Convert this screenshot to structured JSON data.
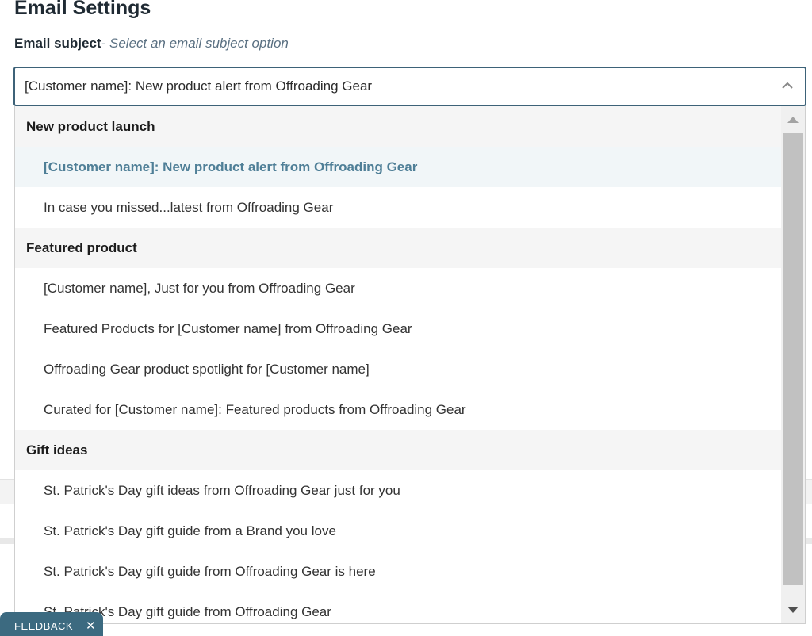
{
  "page": {
    "title": "Email Settings"
  },
  "email_subject": {
    "label": "Email subject",
    "hint": "- Select an email subject option",
    "selected_value": "[Customer name]: New product alert from Offroading Gear"
  },
  "dropdown": {
    "groups": [
      {
        "header": "New product launch",
        "options": [
          {
            "label": "[Customer name]: New product alert from Offroading Gear",
            "selected": true
          },
          {
            "label": "In case you missed...latest from Offroading Gear"
          }
        ]
      },
      {
        "header": "Featured product",
        "options": [
          {
            "label": "[Customer name], Just for you from Offroading Gear"
          },
          {
            "label": "Featured Products for [Customer name] from Offroading Gear"
          },
          {
            "label": "Offroading Gear product spotlight for [Customer name]"
          },
          {
            "label": "Curated for [Customer name]: Featured products from Offroading Gear"
          }
        ]
      },
      {
        "header": "Gift ideas",
        "options": [
          {
            "label": "St. Patrick's Day gift ideas from Offroading Gear just for you"
          },
          {
            "label": "St. Patrick's Day gift guide from a Brand you love"
          },
          {
            "label": "St. Patrick's Day gift guide from Offroading Gear is here"
          },
          {
            "label": "St. Patrick's Day gift guide from Offroading Gear"
          }
        ]
      }
    ]
  },
  "feedback": {
    "label": "FEEDBACK",
    "close": "✕"
  },
  "icons": {
    "select": "chevron-up-icon",
    "scroll_up": "scroll-up-arrow-icon",
    "scroll_down": "scroll-down-arrow-icon"
  },
  "colors": {
    "accent": "#3d6278",
    "selected_text": "#4f7f97",
    "selected_bg": "#f1f6f8",
    "feedback_bg": "#3c6a80"
  }
}
